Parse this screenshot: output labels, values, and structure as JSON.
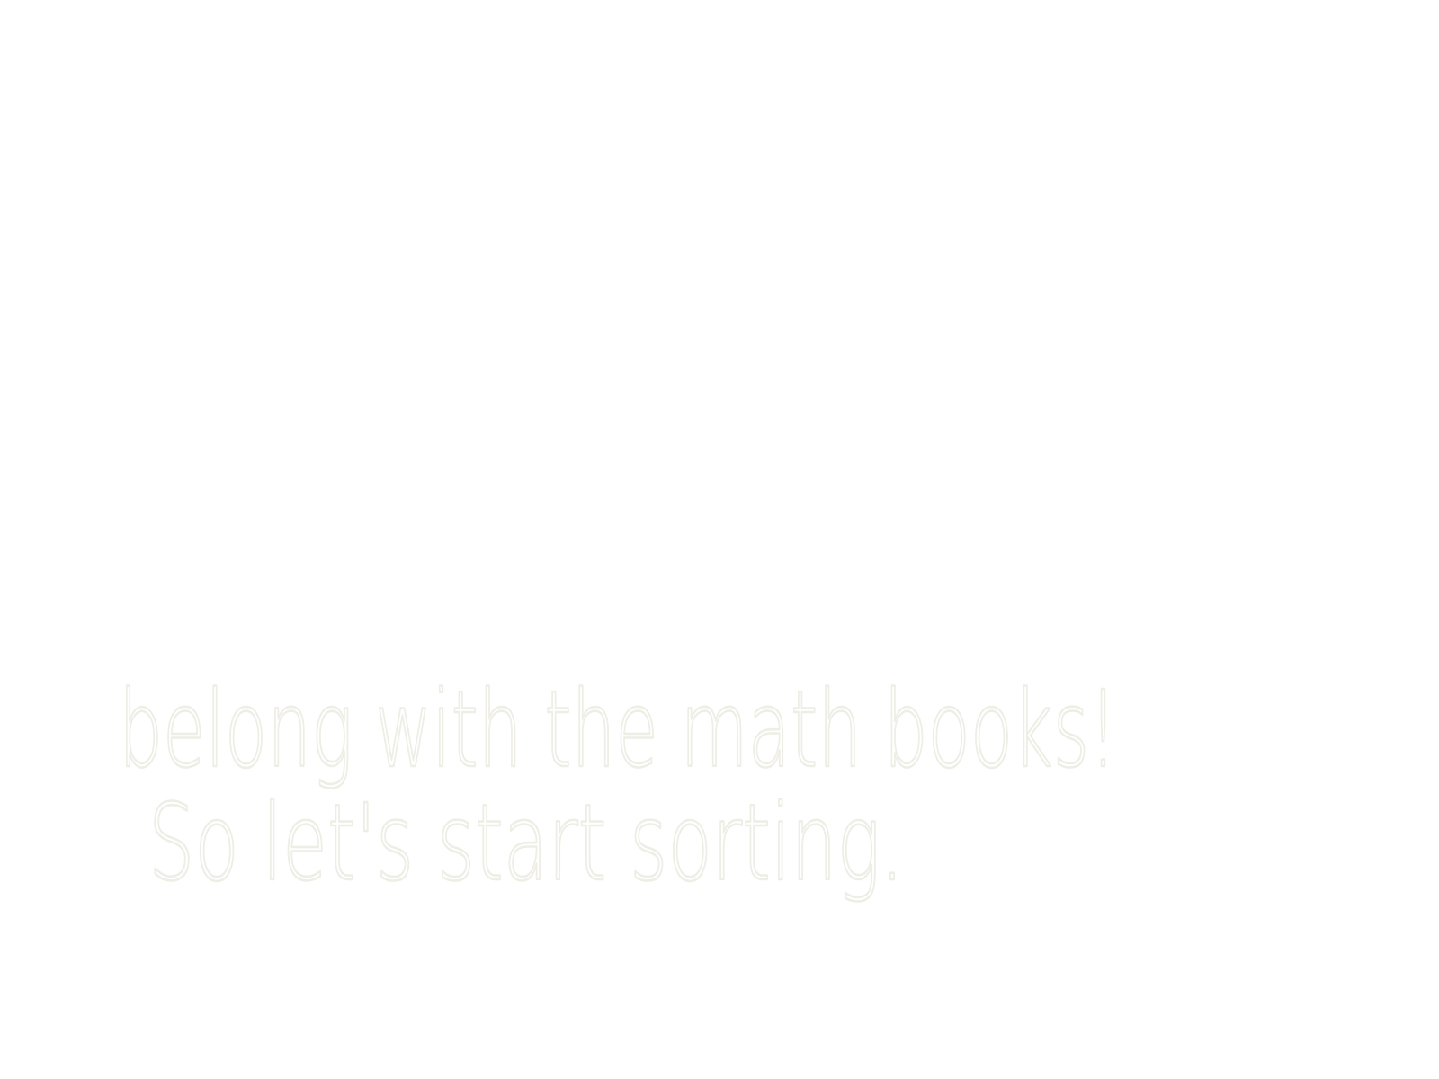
{
  "canvas": {
    "background_color": "#ffffff",
    "ink_color": "#eeeee6"
  },
  "caption": {
    "line1": "belong with the math books!",
    "line2": "So let's start sorting."
  }
}
